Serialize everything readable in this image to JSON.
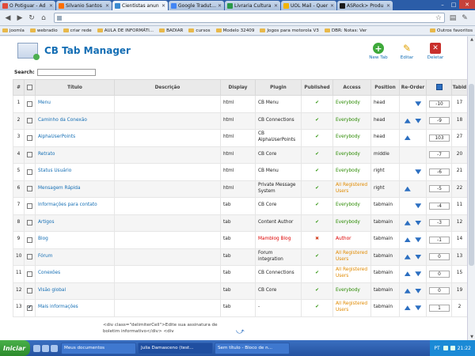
{
  "browser": {
    "tabs": [
      {
        "label": "O Potiguar - Ad",
        "color": "#e04a3a"
      },
      {
        "label": "Silvanio Santos",
        "color": "#ff6f00"
      },
      {
        "label": "Cientistas anun",
        "color": "#3a8ad0",
        "active": true
      },
      {
        "label": "Google Tradutor",
        "color": "#4285f4"
      },
      {
        "label": "Livraria Cultura",
        "color": "#2a9a4a"
      },
      {
        "label": "UOL Mail - Quer",
        "color": "#f2b300"
      },
      {
        "label": "ASRock> Produ",
        "color": "#1a1a1a"
      }
    ],
    "bookmarks": [
      "joomla",
      "webradio",
      "criar rede",
      "AULA  DE INFORMÁTI...",
      "BADIAR",
      "cursos",
      "Modelo 32409",
      "Jogos para motorola V3",
      "DBR: Notas: Ver"
    ],
    "bookmarks_right": "Outros favoritos"
  },
  "header": {
    "title": "CB Tab Manager",
    "new_label": "New Tab",
    "edit_label": "Editar",
    "delete_label": "Deletar"
  },
  "search": {
    "label": "Search:"
  },
  "columns": {
    "num": "#",
    "title": "Título",
    "desc": "Descrição",
    "display": "Display",
    "plugin": "Plugin",
    "published": "Published",
    "access": "Access",
    "position": "Position",
    "reorder": "Re-Order",
    "tabid": "Tabid"
  },
  "rows": [
    {
      "num": "1",
      "title": "Menu",
      "display": "html",
      "plugin": "CB Menu",
      "pub": true,
      "access": "Everybody",
      "acc": "green",
      "position": "head",
      "up": false,
      "down": true,
      "order": "-10",
      "tabid": "17",
      "checked": false
    },
    {
      "num": "2",
      "title": "Caminho da Conexão",
      "display": "html",
      "plugin": "CB Connections",
      "pub": true,
      "access": "Everybody",
      "acc": "green",
      "position": "head",
      "up": true,
      "down": true,
      "order": "-9",
      "tabid": "18",
      "checked": false
    },
    {
      "num": "3",
      "title": "AlphaUserPoints",
      "display": "html",
      "plugin": "CB AlphaUserPoints",
      "pub": true,
      "access": "Everybody",
      "acc": "green",
      "position": "head",
      "up": true,
      "down": false,
      "order": "103",
      "tabid": "27",
      "checked": false
    },
    {
      "num": "4",
      "title": "Retrato",
      "display": "html",
      "plugin": "CB Core",
      "pub": true,
      "access": "Everybody",
      "acc": "green",
      "position": "middle",
      "up": false,
      "down": false,
      "order": "-7",
      "tabid": "20",
      "checked": false
    },
    {
      "num": "5",
      "title": "Status Usuário",
      "display": "html",
      "plugin": "CB Menu",
      "pub": true,
      "access": "Everybody",
      "acc": "green",
      "position": "right",
      "up": false,
      "down": true,
      "order": "-6",
      "tabid": "21",
      "checked": false
    },
    {
      "num": "6",
      "title": "Mensagem Rápida",
      "display": "html",
      "plugin": "Private Message System",
      "pub": true,
      "access": "All Registered Users",
      "acc": "orange",
      "position": "right",
      "up": true,
      "down": false,
      "order": "-5",
      "tabid": "22",
      "checked": false
    },
    {
      "num": "7",
      "title": "Informações para contato",
      "display": "tab",
      "plugin": "CB Core",
      "pub": true,
      "access": "Everybody",
      "acc": "green",
      "position": "tabmain",
      "up": false,
      "down": true,
      "order": "-4",
      "tabid": "11",
      "checked": false
    },
    {
      "num": "8",
      "title": "Artigos",
      "display": "tab",
      "plugin": "Content Author",
      "pub": true,
      "access": "Everybody",
      "acc": "green",
      "position": "tabmain",
      "up": true,
      "down": true,
      "order": "-3",
      "tabid": "12",
      "checked": false
    },
    {
      "num": "9",
      "title": "Blog",
      "display": "tab",
      "plugin": "Mamblog Blog",
      "pluginRed": true,
      "pub": false,
      "access": "Author",
      "acc": "red",
      "position": "tabmain",
      "up": true,
      "down": true,
      "order": "-1",
      "tabid": "14",
      "checked": false
    },
    {
      "num": "10",
      "title": "Fórum",
      "display": "tab",
      "plugin": "Forum integration",
      "pub": true,
      "access": "All Registered Users",
      "acc": "orange",
      "position": "tabmain",
      "up": true,
      "down": true,
      "order": "0",
      "tabid": "13",
      "checked": false
    },
    {
      "num": "11",
      "title": "Conexões",
      "display": "tab",
      "plugin": "CB Connections",
      "pub": true,
      "access": "All Registered Users",
      "acc": "orange",
      "position": "tabmain",
      "up": true,
      "down": true,
      "order": "0",
      "tabid": "15",
      "checked": false
    },
    {
      "num": "12",
      "title": "Visão global",
      "display": "tab",
      "plugin": "CB Core",
      "pub": true,
      "access": "Everybody",
      "acc": "green",
      "position": "tabmain",
      "up": true,
      "down": true,
      "order": "0",
      "tabid": "19",
      "checked": false
    },
    {
      "num": "13",
      "title": "Mais informações",
      "display": "tab",
      "plugin": "-",
      "pub": true,
      "access": "All Registered Users",
      "acc": "orange",
      "position": "tabmain",
      "up": true,
      "down": true,
      "order": "1",
      "tabid": "2",
      "checked": true
    }
  ],
  "trailing_desc": "<div class=\"delimiterCell\">Edite sua assinatura de boletim informativo</div> <div",
  "taskbar": {
    "start": "Iniciar",
    "tasks": [
      "Meus documentos",
      "Julia Damasceno (test...",
      "Sem título - Bloco de n..."
    ],
    "active_task": 1,
    "lang": "PT",
    "time": "21:22"
  }
}
